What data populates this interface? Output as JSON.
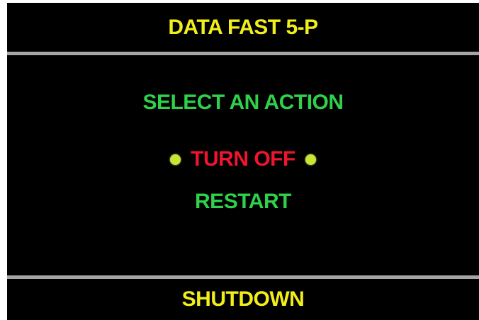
{
  "header": {
    "title": "DATA FAST 5-P"
  },
  "menu": {
    "prompt": "SELECT AN ACTION",
    "options": [
      {
        "label": "TURN OFF",
        "selected": true
      },
      {
        "label": "RESTART",
        "selected": false
      }
    ]
  },
  "footer": {
    "title": "SHUTDOWN"
  },
  "colors": {
    "background": "#000000",
    "title_yellow": "#f2ee1a",
    "prompt_green": "#2fd14a",
    "selected_red": "#f0152e",
    "bullet_yellow_green": "#c6e534",
    "divider_gray": "#a6a6a6"
  },
  "icons": {
    "selection_marker": "bullet-dot-icon"
  }
}
